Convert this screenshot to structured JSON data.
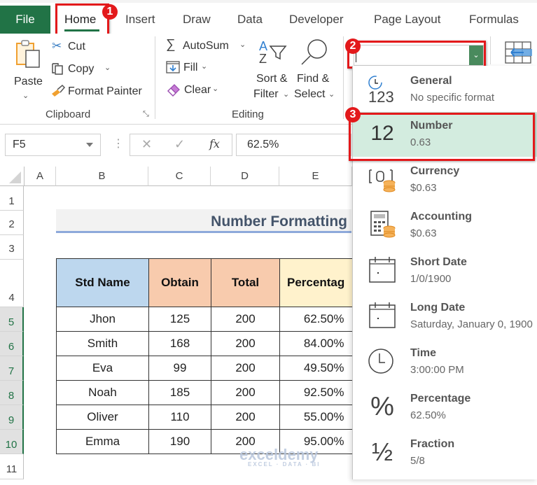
{
  "tabs": [
    {
      "label": "File"
    },
    {
      "label": "Home"
    },
    {
      "label": "Insert"
    },
    {
      "label": "Draw"
    },
    {
      "label": "Data"
    },
    {
      "label": "Developer"
    },
    {
      "label": "Page Layout"
    },
    {
      "label": "Formulas"
    }
  ],
  "callouts": [
    "1",
    "2",
    "3"
  ],
  "ribbon": {
    "clipboard": {
      "paste": "Paste",
      "cut": "Cut",
      "copy": "Copy",
      "format_painter": "Format Painter",
      "group_label": "Clipboard"
    },
    "editing": {
      "autosum": "AutoSum",
      "fill": "Fill",
      "clear": "Clear",
      "sort_filter_1": "Sort &",
      "sort_filter_2": "Filter",
      "find_select_1": "Find &",
      "find_select_2": "Select",
      "group_label": "Editing"
    },
    "number_format_value": ""
  },
  "formula_bar": {
    "name_box": "F5",
    "formula": "62.5%"
  },
  "columns": [
    "A",
    "B",
    "C",
    "D",
    "E"
  ],
  "rows": [
    "1",
    "2",
    "3",
    "4",
    "5",
    "6",
    "7",
    "8",
    "9",
    "10",
    "11"
  ],
  "sheet": {
    "title": "Number Formatting",
    "headers": [
      "Std Name",
      "Obtain",
      "Total",
      "Percentag"
    ],
    "header_colors": [
      "#bdd7ee",
      "#f8cbad",
      "#f8cbad",
      "#fff2cc"
    ],
    "records": [
      [
        "Jhon",
        "125",
        "200",
        "62.50%"
      ],
      [
        "Smith",
        "168",
        "200",
        "84.00%"
      ],
      [
        "Eva",
        "99",
        "200",
        "49.50%"
      ],
      [
        "Noah",
        "185",
        "200",
        "92.50%"
      ],
      [
        "Oliver",
        "110",
        "200",
        "55.00%"
      ],
      [
        "Emma",
        "190",
        "200",
        "95.00%"
      ]
    ]
  },
  "format_menu": [
    {
      "name": "General",
      "sample": "No specific format",
      "icon": "general-123-icon"
    },
    {
      "name": "Number",
      "sample": "0.63",
      "icon": "number-12-icon",
      "selected": true
    },
    {
      "name": "Currency",
      "sample": "$0.63",
      "icon": "currency-icon"
    },
    {
      "name": "Accounting",
      "sample": " $0.63",
      "icon": "accounting-icon"
    },
    {
      "name": "Short Date",
      "sample": "1/0/1900",
      "icon": "calendar-icon"
    },
    {
      "name": "Long Date",
      "sample": "Saturday, January 0, 1900",
      "icon": "calendar-icon"
    },
    {
      "name": "Time",
      "sample": "3:00:00 PM",
      "icon": "clock-icon"
    },
    {
      "name": "Percentage",
      "sample": "62.50%",
      "icon": "percent-icon"
    },
    {
      "name": "Fraction",
      "sample": " 5/8",
      "icon": "fraction-icon"
    }
  ],
  "watermark": {
    "brand": "exceldemy",
    "tagline": "EXCEL · DATA · BI"
  },
  "colors": {
    "excel_green": "#217346",
    "callout_red": "#e3191b",
    "selected_item": "#d3ecdf"
  }
}
